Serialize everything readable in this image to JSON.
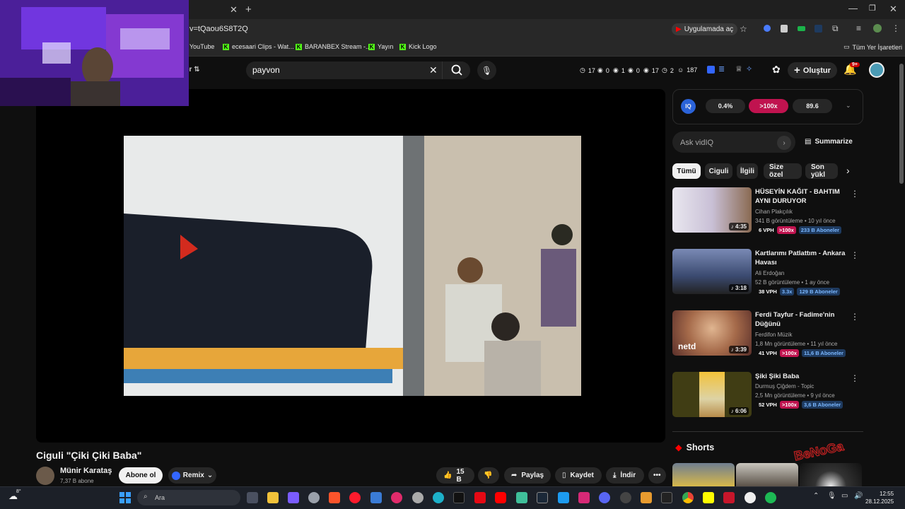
{
  "browser": {
    "url_fragment": "v=tQaou6S8T2Q",
    "open_in_app": "Uygulamada aç",
    "bookmarks": [
      "YouTube",
      "ecesaari Clips - Wat...",
      "BARANBEX Stream -...",
      "Yayın",
      "Kick Logo"
    ],
    "all_bookmarks": "Tüm Yer İşaretleri"
  },
  "header": {
    "search_value": "payvon",
    "stats": [
      "17",
      "0",
      "1",
      "0",
      "17",
      "2",
      "187"
    ],
    "create_label": "Oluştur",
    "notif_badge": "9+"
  },
  "video": {
    "title": "Ciguli \"Çiki Çiki Baba\"",
    "channel": "Münir Karataş",
    "subscribers": "7,37 B abone",
    "subscribe_label": "Abone ol",
    "remix_label": "Remix",
    "likes": "15 B",
    "share_label": "Paylaş",
    "save_label": "Kaydet",
    "download_label": "İndir"
  },
  "vidiq": {
    "metrics": [
      "0.4%",
      ">100x",
      "89.6"
    ],
    "ask_placeholder": "Ask vidIQ",
    "summarize_label": "Summarize",
    "chips": [
      "Tümü",
      "Ciguli",
      "İlgili",
      "Size özel",
      "Son yükl"
    ]
  },
  "recommendations": [
    {
      "title": "HÜSEYİN KAĞIT - BAHTIM AYNI DURUYOR",
      "channel": "Cihan Plakçılık",
      "meta": "341 B görüntüleme • 10 yıl önce",
      "vph": "6 VPH",
      "mult": ">100x",
      "subs": "233 B Aboneler",
      "duration": "4:35"
    },
    {
      "title": "Kartlarımı Patlattım - Ankara Havası",
      "channel": "Ali Erdoğan",
      "meta": "52 B görüntüleme • 1 ay önce",
      "vph": "38 VPH",
      "mult": "3.3x",
      "subs": "129 B Aboneler",
      "duration": "3:18"
    },
    {
      "title": "Ferdi Tayfur - Fadime'nin Düğünü",
      "channel": "Ferdifon Müzik",
      "meta": "1,8 Mn görüntüleme • 11 yıl önce",
      "vph": "41 VPH",
      "mult": ">100x",
      "subs": "11,6 B Aboneler",
      "duration": "3:39"
    },
    {
      "title": "Şiki Şiki Baba",
      "channel": "Durmuş Çiğdem - Topic",
      "meta": "2,5 Mn görüntüleme • 9 yıl önce",
      "vph": "52 VPH",
      "mult": ">100x",
      "subs": "3,6 B Aboneler",
      "duration": "6:06"
    }
  ],
  "shorts_label": "Shorts",
  "taskbar": {
    "search_placeholder": "Ara",
    "time": "12:55",
    "date": "28.12.2025",
    "temp": "8°"
  }
}
